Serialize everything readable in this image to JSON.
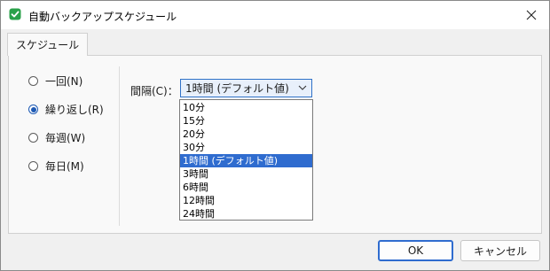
{
  "window": {
    "title": "自動バックアップスケジュール",
    "accent": "#2f6ccf",
    "icon_color": "#2aa14a"
  },
  "tabs": [
    {
      "label": "スケジュール"
    }
  ],
  "schedule_options": [
    {
      "label": "一回(N)",
      "checked": false
    },
    {
      "label": "繰り返し(R)",
      "checked": true
    },
    {
      "label": "毎週(W)",
      "checked": false
    },
    {
      "label": "毎日(M)",
      "checked": false
    }
  ],
  "interval": {
    "label": "間隔(C)：",
    "selected": "1時間 (デフォルト値)",
    "options": [
      "10分",
      "15分",
      "20分",
      "30分",
      "1時間 (デフォルト値)",
      "3時間",
      "6時間",
      "12時間",
      "24時間"
    ],
    "highlighted_index": 4
  },
  "buttons": {
    "ok": "OK",
    "cancel": "キャンセル"
  }
}
